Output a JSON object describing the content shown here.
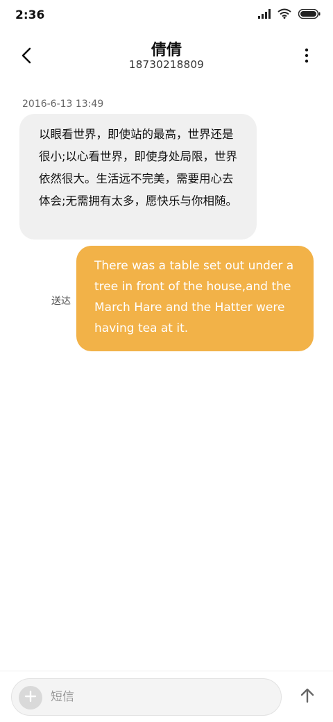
{
  "status_bar": {
    "time": "2:36",
    "icons": [
      "signal-icon",
      "wifi-icon",
      "battery-icon"
    ]
  },
  "header": {
    "contact_name": "倩倩",
    "contact_number": "18730218809",
    "back_icon": "chevron-left-icon",
    "more_icon": "more-vertical-icon"
  },
  "conversation": {
    "timestamp": "2016-6-13 13:49",
    "incoming_message": "以眼看世界，即使站的最高，世界还是很小;以心看世界，即使身处局限，世界依然很大。生活远不完美，需要用心去体会;无需拥有太多，愿快乐与你相随。",
    "delivered_label": "送达",
    "outgoing_message": "There was a table set out under a tree in front of the house,and the March Hare and the Hatter were having tea at it."
  },
  "composer": {
    "placeholder": "短信",
    "add_icon": "plus-icon",
    "send_icon": "arrow-up-icon"
  },
  "colors": {
    "outgoing_bubble": "#f2b248",
    "incoming_bubble": "#f0f0f0",
    "background": "#ffffff"
  }
}
